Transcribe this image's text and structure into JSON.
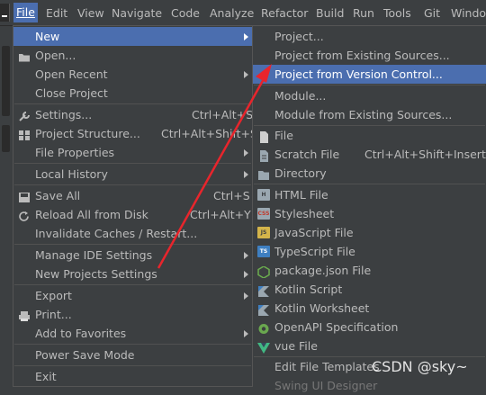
{
  "menubar": {
    "items": [
      "File",
      "Edit",
      "View",
      "Navigate",
      "Code",
      "Analyze",
      "Refactor",
      "Build",
      "Run",
      "Tools",
      "Git",
      "Windo"
    ]
  },
  "file_menu": {
    "new": "New",
    "open": "Open...",
    "open_recent": "Open Recent",
    "close_project": "Close Project",
    "settings": "Settings...",
    "settings_sc": "Ctrl+Alt+S",
    "project_structure": "Project Structure...",
    "project_structure_sc": "Ctrl+Alt+Shift+S",
    "file_properties": "File Properties",
    "local_history": "Local History",
    "save_all": "Save All",
    "save_all_sc": "Ctrl+S",
    "reload": "Reload All from Disk",
    "reload_sc": "Ctrl+Alt+Y",
    "invalidate": "Invalidate Caches / Restart...",
    "manage_ide": "Manage IDE Settings",
    "new_projects_settings": "New Projects Settings",
    "export": "Export",
    "print": "Print...",
    "add_favorites": "Add to Favorites",
    "power_save": "Power Save Mode",
    "exit": "Exit"
  },
  "new_menu": {
    "project": "Project...",
    "project_existing": "Project from Existing Sources...",
    "project_vcs": "Project from Version Control...",
    "module": "Module...",
    "module_existing": "Module from Existing Sources...",
    "file": "File",
    "scratch": "Scratch File",
    "scratch_sc": "Ctrl+Alt+Shift+Insert",
    "directory": "Directory",
    "html": "HTML File",
    "stylesheet": "Stylesheet",
    "js": "JavaScript File",
    "ts": "TypeScript File",
    "package_json": "package.json File",
    "kotlin_script": "Kotlin Script",
    "kotlin_worksheet": "Kotlin Worksheet",
    "openapi": "OpenAPI Specification",
    "vue": "vue File",
    "edit_templates": "Edit File Templates",
    "swing": "Swing UI Designer"
  },
  "watermark": "CSDN @sky~",
  "icons": {
    "open": "folder-icon",
    "settings": "wrench-icon",
    "project_structure": "project-structure-icon",
    "save_all": "save-icon",
    "reload": "reload-icon",
    "print": "printer-icon",
    "file": "file-icon",
    "scratch": "scratch-file-icon",
    "directory": "folder-icon",
    "html": "html-icon",
    "css": "css-icon",
    "js": "js-icon",
    "ts": "ts-icon",
    "package_json": "nodejs-icon",
    "kotlin": "kotlin-icon",
    "openapi": "openapi-icon",
    "vue": "vue-icon"
  },
  "colors": {
    "menu_bg": "#3c3f41",
    "selection": "#4b6eaf",
    "text": "#bbbbbb",
    "arrow": "#e8252c"
  }
}
